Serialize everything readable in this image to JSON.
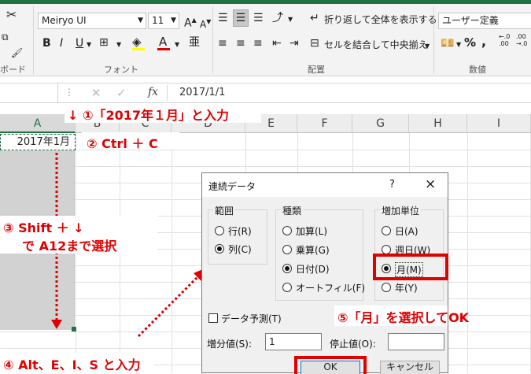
{
  "ribbon": {
    "font_name": "Meiryo UI",
    "font_size": "11",
    "wrap_text": "折り返して全体を表示する",
    "merge_center": "セルを結合して中央揃え",
    "number_format": "ユーザー定義",
    "bold": "B",
    "italic": "I",
    "underline": "U",
    "group_clipboard": "ボード",
    "group_font": "フォント",
    "group_alignment": "配置",
    "group_number": "数値"
  },
  "formula_bar": {
    "fx": "fx",
    "value": "2017/1/1"
  },
  "grid": {
    "columns": [
      "A",
      "B",
      "C",
      "D",
      "E",
      "F",
      "G",
      "H",
      "I"
    ],
    "cell_a1": "2017年1月"
  },
  "annotations": {
    "step1": "↓ ①「2017年１月」と入力",
    "step2": "② Ctrl ＋ C",
    "step3_line1": "③ Shift ＋ ↓",
    "step3_line2": "で A12まで選択",
    "step4": "④ Alt、E、I、S と入力",
    "step5": "⑤「月」を選択してOK"
  },
  "dialog": {
    "title": "連続データ",
    "help": "?",
    "close": "×",
    "range_group": "範囲",
    "range_options": [
      "行(R)",
      "列(C)"
    ],
    "type_group": "種類",
    "type_options": [
      "加算(L)",
      "乗算(G)",
      "日付(D)",
      "オートフィル(F)"
    ],
    "unit_group": "増加単位",
    "unit_options": [
      "日(A)",
      "週日(W)",
      "月(M)",
      "年(Y)"
    ],
    "trend_label": "データ予測(T)",
    "step_label": "増分値(S):",
    "step_value": "1",
    "stop_label": "停止値(O):",
    "stop_value": "",
    "ok": "OK",
    "cancel": "キャンセル"
  },
  "colors": {
    "accent": "#217346",
    "annotation": "#e00000",
    "selection": "#d2d2d2"
  }
}
